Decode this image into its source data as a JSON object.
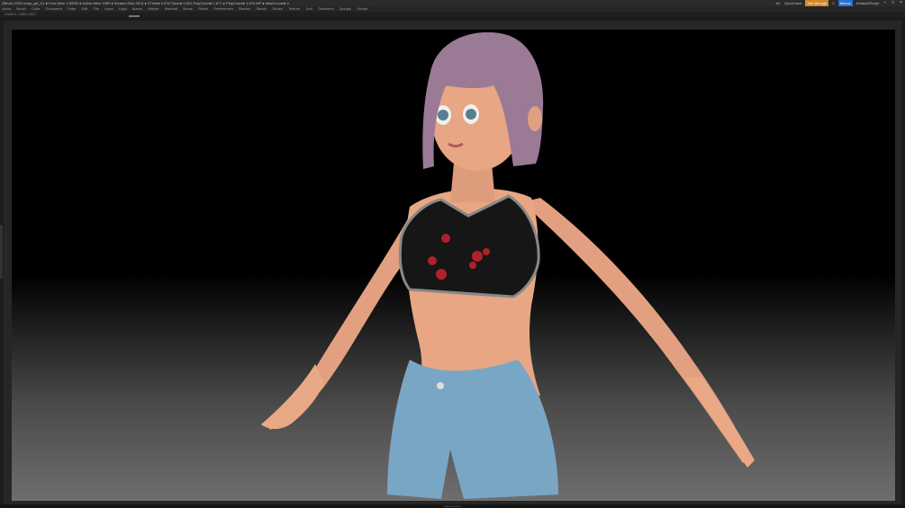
{
  "titlebar": {
    "app_info": "ZBrush 2019   retop_girl_01   ● Free Mem 1.89GB ● Active Mem 1969 ● Scratch Disk 2674 ● ZTime● 9.476 Timer● 0.001 PolyCount● 1.677 ● PolyCount● 1.676 MP ● MeshCount● 2",
    "items": [
      "AC",
      "QuickSave",
      "See-through",
      "0",
      "Menus",
      "DefaultZScript"
    ]
  },
  "menubar": {
    "items": [
      "Alpha",
      "Brush",
      "Color",
      "Document",
      "Draw",
      "Edit",
      "File",
      "Layer",
      "Light",
      "Macro",
      "Marker",
      "Material",
      "Movie",
      "Picker",
      "Preferences",
      "Render",
      "Stencil",
      "Stroke",
      "Texture",
      "Tool",
      "Transform",
      "Zplugin",
      "Zscript"
    ]
  },
  "subbar": {
    "info": "ZDIM 1 / 0001.0017"
  },
  "statusbar": {
    "text": "Camera: persp"
  },
  "colors": {
    "accent": "#d08a2a",
    "skin": "#e8a684",
    "hair": "#9a7a95",
    "shorts": "#7aa6c6",
    "top": "#161616",
    "hearts": "#b0202a"
  },
  "icons": [
    "minimize-icon",
    "maximize-icon",
    "close-icon"
  ]
}
